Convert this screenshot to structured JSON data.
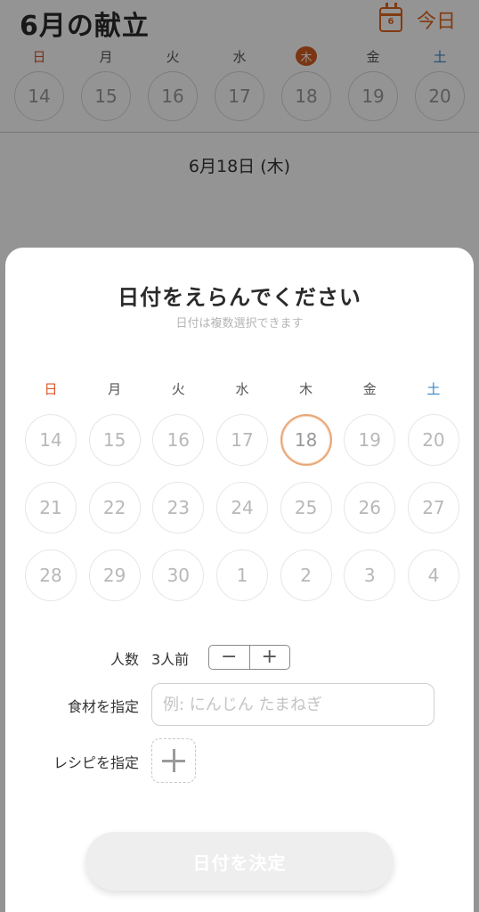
{
  "header": {
    "month_title": "6月の献立",
    "calendar_icon_number": "6",
    "today_label": "今日"
  },
  "background_week": {
    "days": [
      {
        "dow": "日",
        "date": "14"
      },
      {
        "dow": "月",
        "date": "15"
      },
      {
        "dow": "火",
        "date": "16"
      },
      {
        "dow": "水",
        "date": "17"
      },
      {
        "dow": "木",
        "date": "18"
      },
      {
        "dow": "金",
        "date": "19"
      },
      {
        "dow": "土",
        "date": "20"
      }
    ],
    "current_index": 4
  },
  "selected_date_label": "6月18日 (木)",
  "modal": {
    "title": "日付をえらんでください",
    "subtitle": "日付は複数選択できます",
    "weekdays": [
      "日",
      "月",
      "火",
      "水",
      "木",
      "金",
      "土"
    ],
    "weeks": [
      [
        "14",
        "15",
        "16",
        "17",
        "18",
        "19",
        "20"
      ],
      [
        "21",
        "22",
        "23",
        "24",
        "25",
        "26",
        "27"
      ],
      [
        "28",
        "29",
        "30",
        "1",
        "2",
        "3",
        "4"
      ]
    ],
    "today_date": "18",
    "servings_label": "人数",
    "servings_value": "3人前",
    "minus_symbol": "−",
    "plus_symbol": "+",
    "ingredients_label": "食材を指定",
    "ingredients_placeholder": "例: にんじん たまねぎ",
    "ingredients_value": "",
    "recipe_label": "レシピを指定",
    "confirm_label": "日付を決定"
  },
  "colors": {
    "accent": "#e0651e",
    "sunday": "#d9552a",
    "saturday": "#3a86c8",
    "today_ring": "#e9a777"
  }
}
